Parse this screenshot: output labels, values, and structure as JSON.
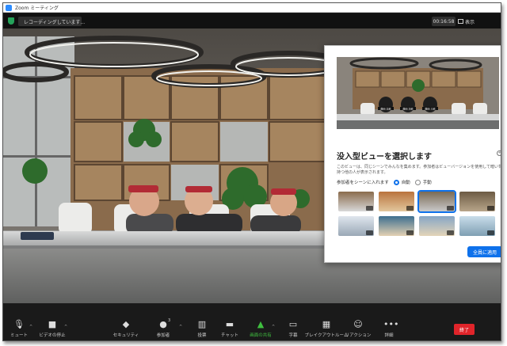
{
  "window": {
    "title": "Zoom ミーティング"
  },
  "infobar": {
    "recording_text": "レコーディングしています...",
    "timer": "00:16:58",
    "view_label": "表示"
  },
  "toolbar": {
    "mute": "ミュート",
    "stop_video": "ビデオの停止",
    "security": "セキュリティ",
    "participants": "参加者",
    "participants_count": "3",
    "polls": "投票",
    "chat": "チャット",
    "share_screen": "画面の共有",
    "captions": "字幕",
    "breakout": "ブレイクアウトルーム",
    "reactions": "リアクション",
    "more": "詳細",
    "end": "終了",
    "share_color": "#3fbf3f",
    "end_color": "#e0242a"
  },
  "panel": {
    "title": "没入型ビューを選択します",
    "description": [
      "このビューは、同じシーンでみんなを集めます。参加者はビューバージョンを使用して暗い背景を",
      "持つ他の人が表示されます。"
    ],
    "placement_label": "参加者をシーンに入れます",
    "auto_label": "自動",
    "manual_label": "手動",
    "apply_label": "全員に適用",
    "selected_mode": "auto",
    "accent_color": "#0e71eb",
    "thumbnails": [
      "scene-1",
      "scene-2",
      "scene-3",
      "scene-4",
      "scene-5",
      "scene-6",
      "scene-7",
      "scene-8"
    ],
    "selected_thumbnail": 2
  },
  "preview_names": [
    "藤田 太郎",
    "藤田 次郎",
    "藤田 三郎"
  ]
}
